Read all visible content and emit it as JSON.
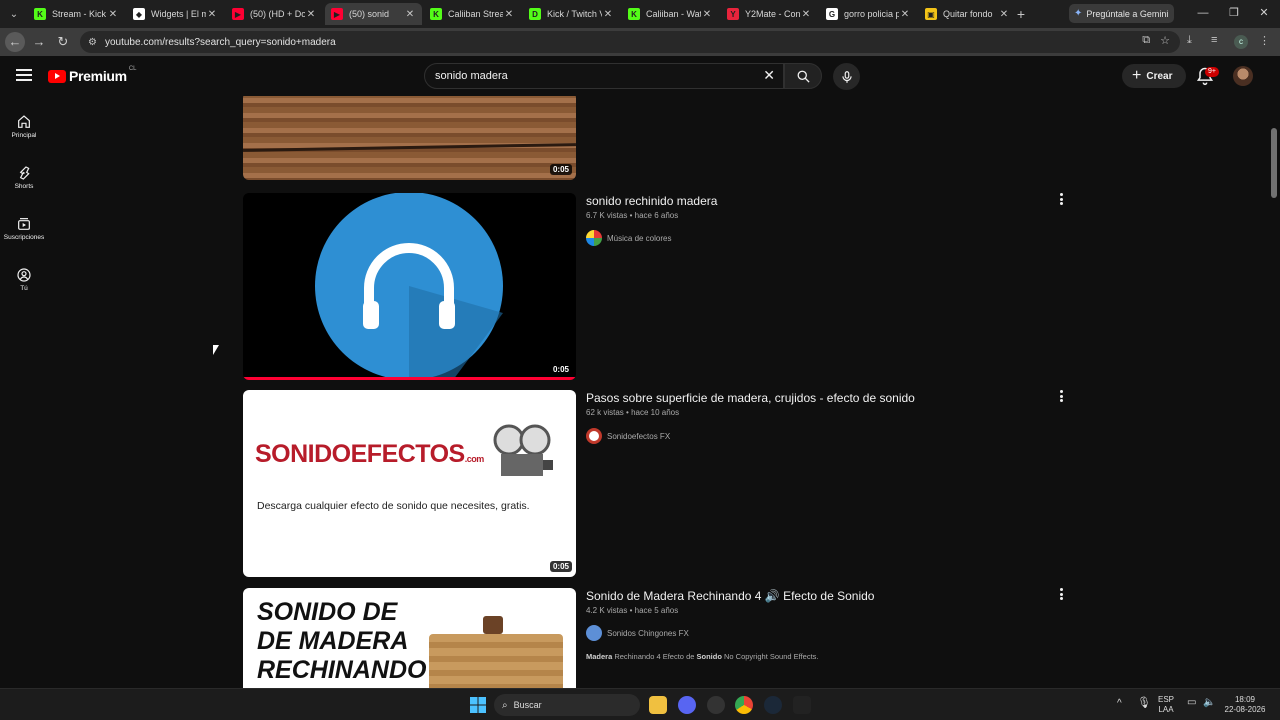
{
  "browser": {
    "tabs": [
      {
        "title": "Stream - Kick",
        "fav_color": "#53fc18",
        "fav_glyph": "K",
        "active": false
      },
      {
        "title": "Widgets | El m",
        "fav_color": "#ffffff",
        "fav_glyph": "◆",
        "active": false
      },
      {
        "title": "(50) (HD + Do",
        "fav_color": "#ff0033",
        "fav_glyph": "▶",
        "active": false
      },
      {
        "title": "(50) sonid",
        "fav_color": "#ff0033",
        "fav_glyph": "▶",
        "active": true
      },
      {
        "title": "Caliiban Strea",
        "fav_color": "#53fc18",
        "fav_glyph": "K",
        "active": false
      },
      {
        "title": "Kick / Twitch V",
        "fav_color": "#53fc18",
        "fav_glyph": "D",
        "active": false
      },
      {
        "title": "Caliiban - Wat",
        "fav_color": "#53fc18",
        "fav_glyph": "K",
        "active": false
      },
      {
        "title": "Y2Mate - Con",
        "fav_color": "#e8243c",
        "fav_glyph": "Y",
        "active": false
      },
      {
        "title": "gorro policia p",
        "fav_color": "#ffffff",
        "fav_glyph": "G",
        "active": false
      },
      {
        "title": "Quitar fondo",
        "fav_color": "#f2c318",
        "fav_glyph": "▣",
        "active": false
      }
    ],
    "gemini_label": "Pregúntale a Gemini",
    "url": "youtube.com/results?search_query=sonido+madera",
    "profile_initial": "c"
  },
  "youtube": {
    "logo_text": "Premium",
    "country_code": "CL",
    "search_value": "sonido madera",
    "create_label": "Crear",
    "notifications_badge": "9+",
    "sidebar": [
      {
        "label": "Principal",
        "icon": "home-icon"
      },
      {
        "label": "Shorts",
        "icon": "shorts-icon"
      },
      {
        "label": "Suscripciones",
        "icon": "subscriptions-icon"
      },
      {
        "label": "Tú",
        "icon": "you-icon"
      }
    ],
    "results": [
      {
        "duration": "0:05"
      },
      {
        "title": "sonido rechinido madera",
        "views": "6.7 K vistas",
        "age": "hace 6 años",
        "channel": "Música de colores",
        "duration": "0:05"
      },
      {
        "title": "Pasos sobre superficie de madera, crujidos - efecto de sonido",
        "views": "62 k vistas",
        "age": "hace 10 años",
        "channel": "Sonidoefectos FX",
        "duration": "0:05",
        "thumb_logo": "SONIDOEFECTOS",
        "thumb_logo_suffix": ".com",
        "thumb_caption": "Descarga cualquier efecto de sonido que necesites, gratis."
      },
      {
        "title": "Sonido de Madera Rechinando 4 🔊 Efecto de Sonido",
        "views": "4.2 K vistas",
        "age": "hace 5 años",
        "channel": "Sonidos Chingones FX",
        "desc_pre": "Madera",
        "desc_mid": " Rechinando 4 Efecto de ",
        "desc_bold2": "Sonido",
        "desc_post": " No Copyright Sound Effects.",
        "thumb_lines": [
          "SONIDO DE",
          "DE MADERA",
          "RECHINANDO"
        ]
      }
    ],
    "meta_sep": "•"
  },
  "taskbar": {
    "search_label": "Buscar",
    "lang_line1": "ESP",
    "lang_line2": "LAA",
    "time": "18:09",
    "date": "22-08-2026"
  }
}
